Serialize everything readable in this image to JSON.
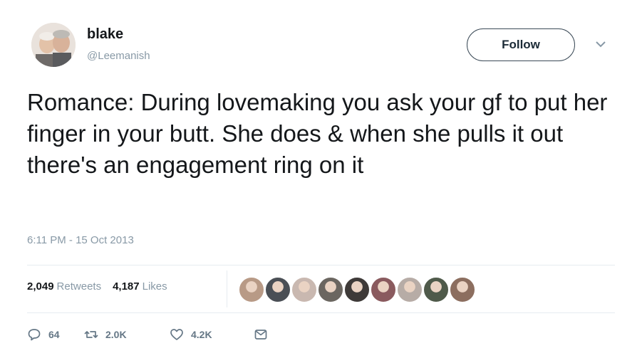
{
  "user": {
    "name": "blake",
    "handle": "@Leemanish",
    "avatar_icon": "profile-photo"
  },
  "follow_label": "Follow",
  "tweet_text": "Romance: During lovemaking you ask your gf to put her finger in your butt. She does & when she pulls it out there's an engagement ring on it",
  "timestamp": "6:11 PM - 15 Oct 2013",
  "stats": {
    "retweets_count": "2,049",
    "retweets_label": "Retweets",
    "likes_count": "4,187",
    "likes_label": "Likes"
  },
  "liker_avatars": [
    "#b89a86",
    "#4a4f55",
    "#c9b8b0",
    "#6b6660",
    "#3e3a38",
    "#8a5a5e",
    "#b7aca6",
    "#4f5a4a",
    "#8c6e5f"
  ],
  "actions": {
    "reply_count": "64",
    "retweet_count": "2.0K",
    "like_count": "4.2K"
  },
  "colors": {
    "text": "#14171a",
    "muted": "#8899a6",
    "divider": "#e6ecf0"
  }
}
